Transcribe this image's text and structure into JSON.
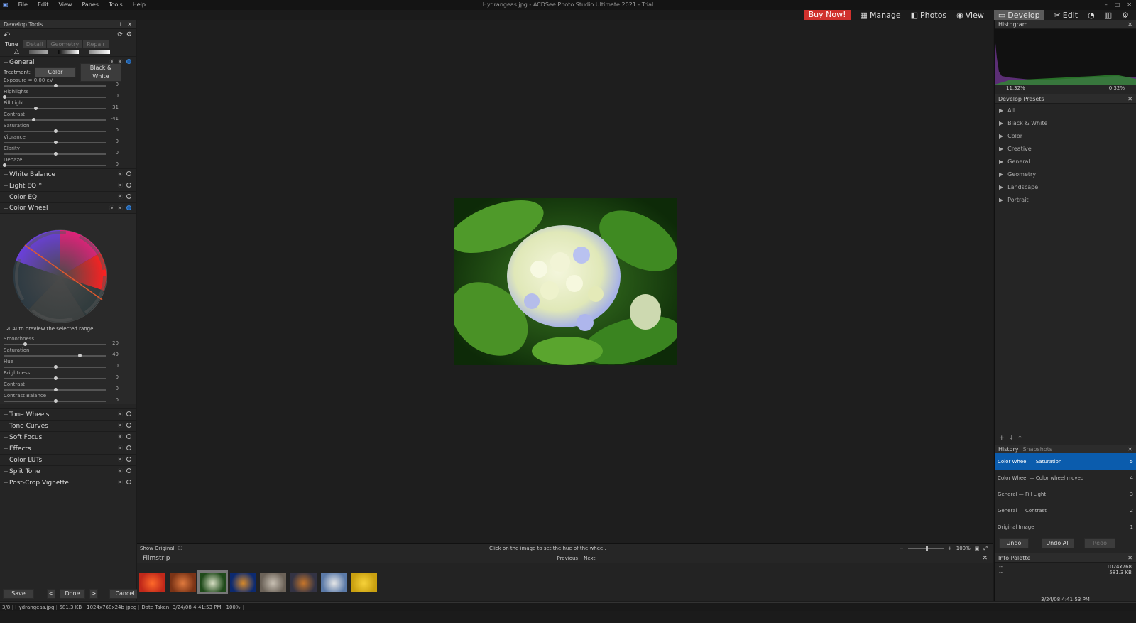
{
  "app": {
    "window_title": "Hydrangeas.jpg - ACDSee Photo Studio Ultimate 2021 - Trial",
    "menu": [
      "File",
      "Edit",
      "View",
      "Panes",
      "Tools",
      "Help"
    ]
  },
  "modes": {
    "buy": "Buy Now!",
    "items": [
      "Manage",
      "Photos",
      "View",
      "Develop",
      "Edit"
    ],
    "active": "Develop"
  },
  "left": {
    "title": "Develop Tools",
    "tabs": [
      "Tune",
      "Detail",
      "Geometry",
      "Repair"
    ],
    "general": {
      "title": "General",
      "treatment_label": "Treatment:",
      "color_btn": "Color",
      "bw_btn": "Black & White",
      "sliders": [
        {
          "label": "Exposure = 0.00 eV",
          "value": "0",
          "pos": 0.5
        },
        {
          "label": "Highlights",
          "value": "0",
          "pos": 0
        },
        {
          "label": "Fill Light",
          "value": "31",
          "pos": 0.31
        },
        {
          "label": "Contrast",
          "value": "-41",
          "pos": 0.29
        },
        {
          "label": "Saturation",
          "value": "0",
          "pos": 0.5
        },
        {
          "label": "Vibrance",
          "value": "0",
          "pos": 0.5
        },
        {
          "label": "Clarity",
          "value": "0",
          "pos": 0.5
        },
        {
          "label": "Dehaze",
          "value": "0",
          "pos": 0
        }
      ]
    },
    "sections_a": [
      "White Balance",
      "Light EQ™",
      "Color EQ"
    ],
    "color_wheel": {
      "title": "Color Wheel",
      "auto_preview": "Auto preview the selected range",
      "sliders": [
        {
          "label": "Smoothness",
          "value": "20",
          "pos": 0.2
        },
        {
          "label": "Saturation",
          "value": "49",
          "pos": 0.74
        },
        {
          "label": "Hue",
          "value": "0",
          "pos": 0.5
        },
        {
          "label": "Brightness",
          "value": "0",
          "pos": 0.5
        },
        {
          "label": "Contrast",
          "value": "0",
          "pos": 0.5
        },
        {
          "label": "Contrast Balance",
          "value": "0",
          "pos": 0.5
        }
      ]
    },
    "sections_b": [
      "Tone Wheels",
      "Tone Curves",
      "Soft Focus",
      "Effects",
      "Color LUTs",
      "Split Tone",
      "Post-Crop Vignette"
    ],
    "footer": {
      "save": "Save",
      "done": "Done",
      "cancel": "Cancel",
      "prev": "<",
      "next": ">"
    }
  },
  "center": {
    "show_original": "Show Original",
    "hint": "Click on the image to set the hue of the wheel.",
    "zoom": "100%"
  },
  "filmstrip": {
    "title": "Filmstrip",
    "previous": "Previous",
    "next": "Next",
    "thumbs": [
      {
        "c1": "#c0281a",
        "c2": "#ff6a2a"
      },
      {
        "c1": "#7a3316",
        "c2": "#e07a3e"
      },
      {
        "c1": "#1f4a1a",
        "c2": "#d8dfc4"
      },
      {
        "c1": "#0c2a70",
        "c2": "#d88a2a"
      },
      {
        "c1": "#6b6258",
        "c2": "#c9c1b4"
      },
      {
        "c1": "#334",
        "c2": "#c8762a"
      },
      {
        "c1": "#5b7aa8",
        "c2": "#e8e8e8"
      },
      {
        "c1": "#c9a010",
        "c2": "#f7d23a"
      }
    ]
  },
  "right": {
    "histogram": {
      "title": "Histogram",
      "left_pct": "11.32%",
      "right_pct": "0.32%"
    },
    "presets": {
      "title": "Develop Presets",
      "items": [
        "All",
        "Black & White",
        "Color",
        "Creative",
        "General",
        "Geometry",
        "Landscape",
        "Portrait"
      ]
    },
    "history": {
      "tab1": "History",
      "tab2": "Snapshots",
      "items": [
        {
          "label": "Color Wheel — Saturation",
          "n": "5"
        },
        {
          "label": "Color Wheel — Color wheel moved",
          "n": "4"
        },
        {
          "label": "General — Fill Light",
          "n": "3"
        },
        {
          "label": "General — Contrast",
          "n": "2"
        },
        {
          "label": "Original Image",
          "n": "1"
        }
      ],
      "undo": "Undo",
      "undo_all": "Undo All",
      "redo": "Redo"
    },
    "info": {
      "title": "Info Palette",
      "dims": "1024x768",
      "size": "581.3 KB",
      "date": "3/24/08 4:41:53 PM",
      "dash": "--"
    }
  },
  "status": {
    "index": "3/8",
    "file": "Hydrangeas.jpg",
    "size": "581.3 KB",
    "format": "1024x768x24b jpeg",
    "date": "Date Taken: 3/24/08 4:41:53 PM",
    "zoom": "100%"
  }
}
